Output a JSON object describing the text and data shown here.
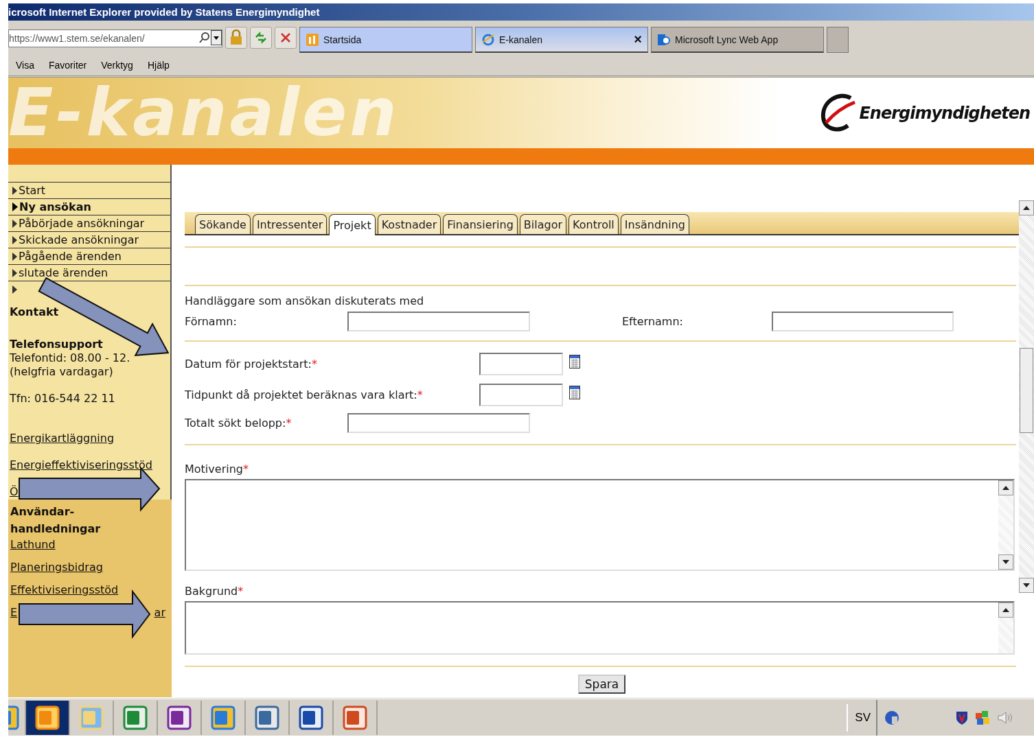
{
  "browser": {
    "title": "icrosoft Internet Explorer provided by Statens Energimyndighet",
    "address": "https://www1.stem.se/ekanalen/",
    "tabs": [
      {
        "label": "Startsida",
        "selected": false,
        "closable": false
      },
      {
        "label": "E-kanalen",
        "selected": true,
        "closable": true
      },
      {
        "label": "Microsoft Lync Web App",
        "selected": false,
        "closable": false
      }
    ],
    "close_mark": "×",
    "menu": [
      "Visa",
      "Favoriter",
      "Verktyg",
      "Hjälp"
    ]
  },
  "banner": {
    "title": "E-kanalen",
    "logo": "Energimyndigheten"
  },
  "sidebar": {
    "nav": [
      {
        "label": "Start",
        "selected": false
      },
      {
        "label": "Ny ansökan",
        "selected": true
      },
      {
        "label": "Påbörjade ansökningar",
        "selected": false
      },
      {
        "label": "Skickade ansökningar",
        "selected": false
      },
      {
        "label": "Pågående ärenden",
        "selected": false
      },
      {
        "label": "slutade ärenden",
        "selected": false
      },
      {
        "selected": false
      }
    ],
    "contact_heading": "Kontakt",
    "support_heading": "Telefonsupport",
    "hours": "Telefontid: 08.00 - 12.",
    "days": "(helgfria vardagar)",
    "phone": "Tfn: 016-544 22 11",
    "links": [
      "Energikartläggning",
      "Energieffektiviseringsstöd",
      "Ö"
    ],
    "guides_heading": [
      "Användar-",
      "handledningar"
    ],
    "guide_links": [
      {
        "text": "Lathund"
      },
      {
        "text": "Planeringsbidrag"
      },
      {
        "text": "Effektiviseringsstöd"
      },
      {
        "text": "E",
        "tail": "ar"
      }
    ]
  },
  "form": {
    "tabs": [
      {
        "label": "Sökande",
        "selected": false
      },
      {
        "label": "Intressenter",
        "selected": false
      },
      {
        "label": "Projekt",
        "selected": true
      },
      {
        "label": "Kostnader",
        "selected": false
      },
      {
        "label": "Finansiering",
        "selected": false
      },
      {
        "label": "Bilagor",
        "selected": false
      },
      {
        "label": "Kontroll",
        "selected": false
      },
      {
        "label": "Insändning",
        "selected": false
      }
    ],
    "contact_heading": "Handläggare som ansökan diskuterats med",
    "first_name": {
      "label": "Förnamn:"
    },
    "last_name": {
      "label": "Efternamn:"
    },
    "required_mark": "*",
    "fields": [
      {
        "label": "Datum för projektstart:",
        "kind": "date",
        "required": true
      },
      {
        "label": "Tidpunkt då projektet beräknas vara klart:",
        "kind": "date",
        "required": true
      },
      {
        "label": "Totalt sökt belopp:",
        "kind": "text",
        "required": true
      }
    ],
    "textareas": [
      {
        "label": "Motivering",
        "required": true
      },
      {
        "label": "Bakgrund",
        "required": true
      }
    ],
    "save_button": "Spara"
  },
  "taskbar": {
    "language": "SV"
  }
}
